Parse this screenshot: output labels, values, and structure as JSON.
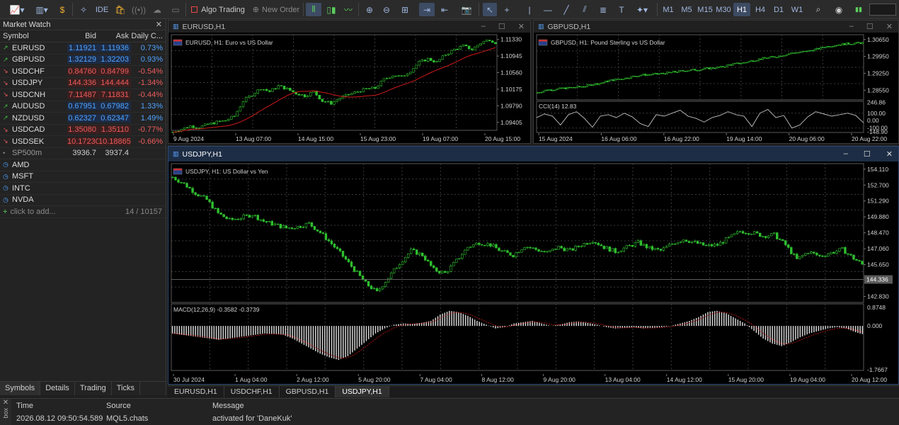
{
  "toolbar": {
    "algo_trading": "Algo Trading",
    "new_order": "New Order",
    "ide": "IDE",
    "timeframes": [
      "M1",
      "M5",
      "M15",
      "M30",
      "H1",
      "H4",
      "D1",
      "W1"
    ],
    "active_timeframe": "H1"
  },
  "market_watch": {
    "title": "Market Watch",
    "columns": [
      "Symbol",
      "Bid",
      "Ask",
      "Daily C..."
    ],
    "rows": [
      {
        "symbol": "EURUSD",
        "bid": "1.11921",
        "ask": "1.11936",
        "change": "0.73%",
        "dir": "up"
      },
      {
        "symbol": "GBPUSD",
        "bid": "1.32129",
        "ask": "1.32203",
        "change": "0.93%",
        "dir": "up"
      },
      {
        "symbol": "USDCHF",
        "bid": "0.84760",
        "ask": "0.84799",
        "change": "-0.54%",
        "dir": "dn"
      },
      {
        "symbol": "USDJPY",
        "bid": "144.336",
        "ask": "144.444",
        "change": "-1.34%",
        "dir": "dn"
      },
      {
        "symbol": "USDCNH",
        "bid": "7.11487",
        "ask": "7.11831",
        "change": "-0.44%",
        "dir": "dn"
      },
      {
        "symbol": "AUDUSD",
        "bid": "0.67951",
        "ask": "0.67982",
        "change": "1.33%",
        "dir": "up"
      },
      {
        "symbol": "NZDUSD",
        "bid": "0.62327",
        "ask": "0.62347",
        "change": "1.49%",
        "dir": "up"
      },
      {
        "symbol": "USDCAD",
        "bid": "1.35080",
        "ask": "1.35110",
        "change": "-0.77%",
        "dir": "dn"
      },
      {
        "symbol": "USDSEK",
        "bid": "10.17230",
        "ask": "10.18865",
        "change": "-0.66%",
        "dir": "dn"
      },
      {
        "symbol": "SP500m",
        "bid": "3936.7",
        "ask": "3937.4",
        "change": "",
        "dir": "gray"
      },
      {
        "symbol": "AMD",
        "bid": "",
        "ask": "",
        "change": "",
        "dir": "none"
      },
      {
        "symbol": "MSFT",
        "bid": "",
        "ask": "",
        "change": "",
        "dir": "none"
      },
      {
        "symbol": "INTC",
        "bid": "",
        "ask": "",
        "change": "",
        "dir": "none"
      },
      {
        "symbol": "NVDA",
        "bid": "",
        "ask": "",
        "change": "",
        "dir": "none"
      }
    ],
    "add_placeholder": "click to add...",
    "count": "14 / 10157",
    "tabs": [
      "Symbols",
      "Details",
      "Trading",
      "Ticks"
    ]
  },
  "colors": {
    "candle_up": "#2fbf2f",
    "ma_line": "#d11a1a",
    "macd_hist": "#d9d9d9",
    "macd_signal": "#d11a1a",
    "cci_line": "#d9d9d9",
    "grid": "#3a3a3a",
    "axis_text": "#d0d0d0",
    "bid_line": "#6b6b6b",
    "active_header": "#1d2d45"
  },
  "charts": [
    {
      "id": "eurusd",
      "window_title": "EURUSD,H1",
      "caption": "EURUSD, H1:  Euro vs US Dollar",
      "chart_data": {
        "type": "candlestick",
        "symbol": "EURUSD",
        "timeframe": "H1",
        "y_ticks": [
          "1.11330",
          "1.10945",
          "1.10560",
          "1.10175",
          "1.09790",
          "1.09405"
        ],
        "x_ticks": [
          "9 Aug 2024",
          "13 Aug 07:00",
          "14 Aug 15:00",
          "15 Aug 23:00",
          "19 Aug 07:00",
          "20 Aug 15:00"
        ],
        "close": [
          1.0918,
          1.0925,
          1.0932,
          1.0929,
          1.0936,
          1.0941,
          1.0945,
          1.0955,
          1.099,
          1.1005,
          1.102,
          1.1012,
          1.1025,
          1.1018,
          1.1008,
          1.1002,
          1.1012,
          1.099,
          1.0985,
          1.0997,
          1.1005,
          1.1012,
          1.1018,
          1.102,
          1.104,
          1.105,
          1.1046,
          1.106,
          1.108,
          1.1088,
          1.108,
          1.1098,
          1.111,
          1.1118,
          1.111,
          1.1125,
          1.1133,
          1.1122
        ],
        "ylim": [
          1.0922,
          1.1144
        ]
      }
    },
    {
      "id": "gbpusd",
      "window_title": "GBPUSD,H1",
      "caption": "GBPUSD, H1:  Pound Sterling vs US Dollar",
      "chart_data": {
        "type": "candlestick",
        "symbol": "GBPUSD",
        "timeframe": "H1",
        "y_ticks": [
          "1.30650",
          "1.29950",
          "1.29250",
          "1.28550"
        ],
        "x_ticks": [
          "15 Aug 2024",
          "16 Aug 06:00",
          "16 Aug 22:00",
          "19 Aug 14:00",
          "20 Aug 06:00",
          "20 Aug 22:00"
        ],
        "close": [
          1.2845,
          1.2855,
          1.2858,
          1.2862,
          1.2865,
          1.2868,
          1.2872,
          1.288,
          1.2885,
          1.2895,
          1.29,
          1.2905,
          1.2912,
          1.2918,
          1.292,
          1.2922,
          1.2925,
          1.293,
          1.2934,
          1.2938,
          1.294,
          1.2944,
          1.2948,
          1.295,
          1.296,
          1.2965,
          1.297,
          1.2978,
          1.2985,
          1.299,
          1.2995,
          1.3002,
          1.301,
          1.3012,
          1.3018,
          1.3025,
          1.3035,
          1.304,
          1.3045,
          1.3048,
          1.305,
          1.3052
        ],
        "ylim": [
          1.2815,
          1.3085
        ]
      },
      "indicator": {
        "label": "CCI(14) 12.83",
        "y_ticks": [
          "246.86",
          "100.00",
          "0.00",
          "-100.00",
          "-148.90"
        ],
        "values": [
          40,
          90,
          60,
          -60,
          80,
          120,
          30,
          -90,
          60,
          80,
          40,
          100,
          50,
          -40,
          -80,
          80,
          60,
          100,
          140,
          60,
          30,
          -20,
          40,
          70,
          120,
          80,
          60,
          -80,
          100,
          150,
          40,
          70,
          -100,
          -60,
          50,
          120,
          90,
          60,
          80,
          100,
          70,
          -30
        ]
      }
    },
    {
      "id": "usdjpy",
      "window_title": "USDJPY,H1",
      "caption": "USDJPY, H1:  US Dollar vs Yen",
      "chart_data": {
        "type": "candlestick",
        "symbol": "USDJPY",
        "timeframe": "H1",
        "y_ticks": [
          "154.110",
          "152.700",
          "151.290",
          "149.880",
          "148.470",
          "147.060",
          "145.650",
          "142.830"
        ],
        "bid_label": "144.336",
        "x_ticks": [
          "30 Jul 2024",
          "1 Aug 04:00",
          "2 Aug 12:00",
          "5 Aug 20:00",
          "7 Aug 04:00",
          "8 Aug 12:00",
          "9 Aug 20:00",
          "13 Aug 04:00",
          "14 Aug 12:00",
          "15 Aug 20:00",
          "19 Aug 04:00",
          "20 Aug 12:00"
        ],
        "close": [
          153.4,
          152.8,
          152.0,
          151.4,
          150.2,
          149.6,
          149.8,
          150.1,
          149.5,
          149.2,
          148.9,
          149.0,
          149.3,
          148.5,
          147.5,
          146.4,
          145.2,
          144.0,
          143.2,
          144.5,
          145.8,
          146.9,
          146.5,
          145.2,
          144.9,
          146.0,
          147.2,
          147.6,
          147.4,
          146.8,
          146.5,
          147.3,
          147.0,
          146.7,
          147.2,
          146.9,
          147.4,
          147.8,
          147.2,
          146.8,
          147.2,
          147.6,
          147.1,
          146.9,
          147.5,
          147.9,
          147.6,
          147.3,
          147.4,
          148.0,
          148.6,
          148.5,
          148.2,
          148.3,
          147.4,
          146.1,
          146.8,
          146.4,
          146.7,
          147.0,
          146.2,
          145.5
        ],
        "ylim": [
          142.3,
          154.6
        ]
      },
      "indicator": {
        "label": "MACD(12,26,9) -0.3582 -0.3739",
        "y_ticks": [
          "0.8748",
          "0.000",
          "-1.7667"
        ],
        "ylim": [
          -1.7667,
          0.8748
        ],
        "values": [
          -0.3,
          -0.35,
          -0.4,
          -0.45,
          -0.5,
          -0.55,
          -0.5,
          -0.45,
          -0.4,
          -0.35,
          -0.3,
          -0.32,
          -0.35,
          -0.5,
          -0.7,
          -0.9,
          -1.1,
          -1.25,
          -1.35,
          -1.2,
          -0.9,
          -0.6,
          -0.3,
          -0.1,
          0.05,
          0.1,
          0.08,
          0.12,
          0.2,
          0.45,
          0.6,
          0.55,
          0.4,
          0.2,
          0.05,
          -0.1,
          -0.05,
          0.1,
          0.15,
          0.2,
          0.1,
          0.0,
          0.05,
          0.15,
          0.18,
          0.12,
          0.05,
          -0.05,
          -0.1,
          -0.08,
          -0.05,
          -0.1,
          -0.08,
          -0.05,
          0.0,
          0.1,
          0.2,
          0.35,
          0.55,
          0.6,
          0.5,
          0.3,
          0.1,
          -0.2,
          -0.5,
          -0.7,
          -0.8,
          -0.65,
          -0.45,
          -0.3,
          -0.2,
          -0.1,
          -0.05,
          -0.1,
          -0.25,
          -0.35
        ]
      }
    }
  ],
  "chart_tabs": [
    "EURUSD,H1",
    "USDCHF,H1",
    "GBPUSD,H1",
    "USDJPY,H1"
  ],
  "active_chart_tab": "USDJPY,H1",
  "log": {
    "side": "box",
    "columns": [
      "Time",
      "Source",
      "Message"
    ],
    "rows": [
      {
        "time": "2026.08.12 09:50:54.589",
        "source": "MQL5.chats",
        "message": "activated for 'DaneKuk'"
      }
    ]
  }
}
